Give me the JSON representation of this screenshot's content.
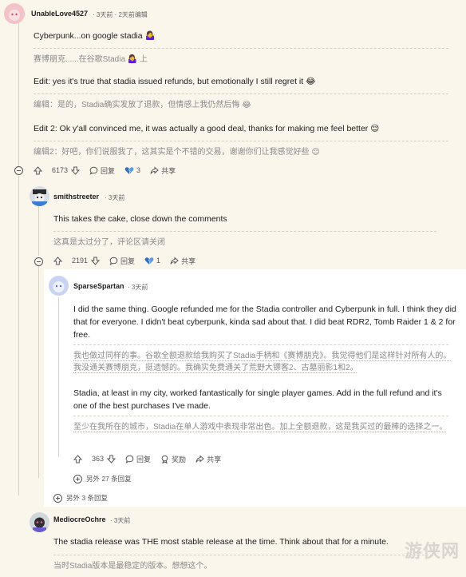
{
  "colors": {
    "background": "#fbf6ec",
    "reply_bg": "#ffffff",
    "link": "#0079d3",
    "trans_text": "#8a8a8a"
  },
  "comments": [
    {
      "user": "UnableLove4527",
      "meta": "· 3天前 · 2天前编辑",
      "paras": [
        "Cyberpunk...on google stadia 🤷‍♀️",
        "赛博朋克......在谷歌Stadia 🤷‍♀️ 上",
        "Edit: yes it's true that stadia issued refunds, but emotionally I still regret it 😂",
        "编辑：是的，Stadia确实发放了退款，但情感上我仍然后悔 😂",
        "Edit 2: Ok y'all convinced me, it was actually a good deal, thanks for making me feel better 😌",
        "编辑2：好吧，你们说服我了，这其实是个不错的交易，谢谢你们让我感觉好些 😌"
      ],
      "votes": "6173",
      "reply": "回复",
      "award_count": "3",
      "share": "共享"
    },
    {
      "user": "smithstreeter",
      "meta": "· 3天前",
      "paras": [
        "This takes the cake, close down the comments",
        "这真是太过分了，评论区请关闭"
      ],
      "votes": "2191",
      "reply": "回复",
      "award_count": "1",
      "share": "共享"
    },
    {
      "user": "SparseSpartan",
      "meta": "· 3天前",
      "paras": [
        "I did the same thing. Google refunded me for the Stadia controller and Cyberpunk in full. I think they did that for everyone. I didn't beat cyberpunk, kinda sad about that. I did beat RDR2, Tomb Raider 1 & 2 for free.",
        "我也做过同样的事。谷歌全额退款给我购买了Stadia手柄和《赛博朋克》。我觉得他们是这样针对所有人的。我没通关赛博朋克，挺遗憾的。我确实免费通关了荒野大镖客2、古墓丽影1和2。",
        "Stadia, at least in my city, worked fantastically for single player games. Add in the full refund and it's one of the best purchases I've made.",
        "至少在我所在的城市，Stadia在单人游戏中表现非常出色。加上全额退款，这是我买过的最棒的选择之一。"
      ],
      "votes": "363",
      "reply": "回复",
      "award_label": "奖励",
      "share": "共享"
    },
    {
      "user": "MediocreOchre",
      "meta": "· 3天前",
      "paras": [
        "The stadia release was THE most stable release at the time. Think about that for a minute.",
        "当时Stadia版本是最稳定的版本。想想这个。"
      ]
    }
  ],
  "more_replies_1": "另外 27 条回复",
  "more_replies_2": "另外 3 条回复",
  "watermark": "游侠网"
}
